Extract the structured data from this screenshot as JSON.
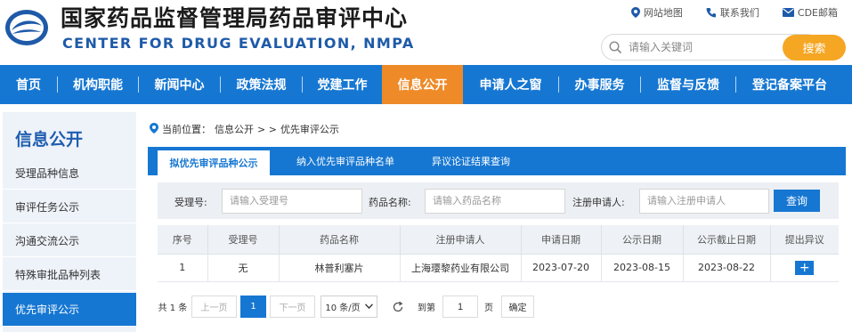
{
  "header": {
    "title_cn": "国家药品监督管理局药品审评中心",
    "title_en": "CENTER FOR DRUG EVALUATION, NMPA",
    "top_links": [
      "网站地图",
      "联系我们",
      "CDE邮箱"
    ],
    "search_placeholder": "请输入关键词",
    "search_button": "搜索"
  },
  "nav": {
    "items": [
      "首页",
      "机构职能",
      "新闻中心",
      "政策法规",
      "党建工作",
      "信息公开",
      "申请人之窗",
      "办事服务",
      "监督与反馈",
      "登记备案平台"
    ],
    "active": "信息公开"
  },
  "sidebar": {
    "title": "信息公开",
    "items": [
      "受理品种信息",
      "审评任务公示",
      "沟通交流公示",
      "特殊审批品种列表",
      "优先审评公示"
    ],
    "active": "优先审评公示"
  },
  "breadcrumb": {
    "prefix": "当前位置：",
    "level1": "信息公开",
    "sep": "> >",
    "level2": "优先审评公示"
  },
  "tabs": [
    "拟优先审评品种公示",
    "纳入优先审评品种名单",
    "异议论证结果查询"
  ],
  "filter": {
    "accept_no_label": "受理号:",
    "accept_no_placeholder": "请输入受理号",
    "drug_name_label": "药品名称:",
    "drug_name_placeholder": "请输入药品名称",
    "applicant_label": "注册申请人:",
    "applicant_placeholder": "请输入注册申请人",
    "query_button": "查询"
  },
  "table": {
    "headers": [
      "序号",
      "受理号",
      "药品名称",
      "注册申请人",
      "申请日期",
      "公示日期",
      "公示截止日期",
      "提出异议"
    ],
    "rows": [
      {
        "no": "1",
        "accept_no": "无",
        "drug_name": "林普利塞片",
        "applicant": "上海璎黎药业有限公司",
        "apply_date": "2023-07-20",
        "publish_date": "2023-08-15",
        "deadline": "2023-08-22",
        "objection": "+"
      }
    ]
  },
  "pagination": {
    "total": "共 1 条",
    "prev": "上一页",
    "current": "1",
    "next": "下一页",
    "page_size": "10 条/页",
    "goto_label": "到第",
    "goto_value": "1",
    "page_unit": "页",
    "confirm": "确定"
  },
  "colors": {
    "brand_blue": "#1677d2",
    "nav_active_orange": "#ee8a27",
    "search_button": "#f5a623"
  }
}
